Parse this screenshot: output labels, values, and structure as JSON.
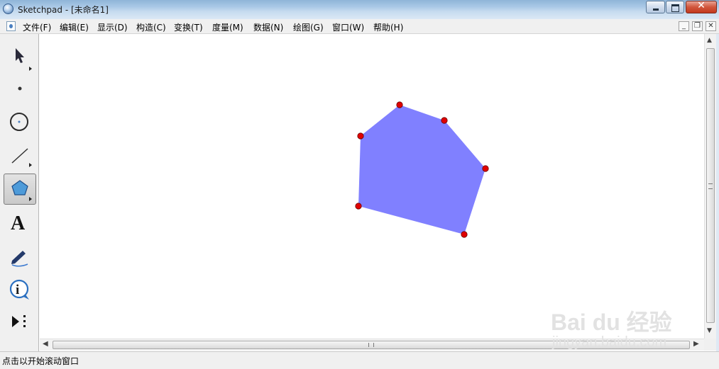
{
  "window": {
    "title": "Sketchpad  - [未命名1]",
    "close_glyph": "✕"
  },
  "menu": {
    "items": [
      {
        "label": "文件(F)"
      },
      {
        "label": "编辑(E)"
      },
      {
        "label": "显示(D)"
      },
      {
        "label": "构造(C)"
      },
      {
        "label": "变换(T)"
      },
      {
        "label": "度量(M)"
      },
      {
        "label": "数据(N)"
      },
      {
        "label": "绘图(G)"
      },
      {
        "label": "窗口(W)"
      },
      {
        "label": "帮助(H)"
      }
    ],
    "doc_buttons": [
      "_",
      "❐",
      "✕"
    ]
  },
  "toolbox": {
    "tools": [
      {
        "name": "selection-arrow-tool",
        "icon": "arrow-cursor-icon",
        "active": false
      },
      {
        "name": "point-tool",
        "icon": "point-icon",
        "active": false
      },
      {
        "name": "compass-tool",
        "icon": "circle-icon",
        "active": false
      },
      {
        "name": "straightedge-tool",
        "icon": "line-segment-icon",
        "active": false
      },
      {
        "name": "polygon-tool",
        "icon": "pentagon-icon",
        "active": true
      },
      {
        "name": "text-tool",
        "icon": "text-a-icon",
        "glyph": "A",
        "active": false
      },
      {
        "name": "marker-tool",
        "icon": "marker-pen-icon",
        "active": false
      },
      {
        "name": "information-tool",
        "icon": "info-icon",
        "glyph": "i",
        "active": false
      },
      {
        "name": "custom-tool",
        "icon": "play-more-icon",
        "active": false
      }
    ]
  },
  "drawing": {
    "polygon_fill": "#8080ff",
    "vertex_color": "#e00000",
    "vertex_count": 6
  },
  "status": {
    "text": "点击以开始滚动窗口"
  },
  "watermark": {
    "logo": "Bai du 经验",
    "url": "jingyan.baidu.com"
  }
}
